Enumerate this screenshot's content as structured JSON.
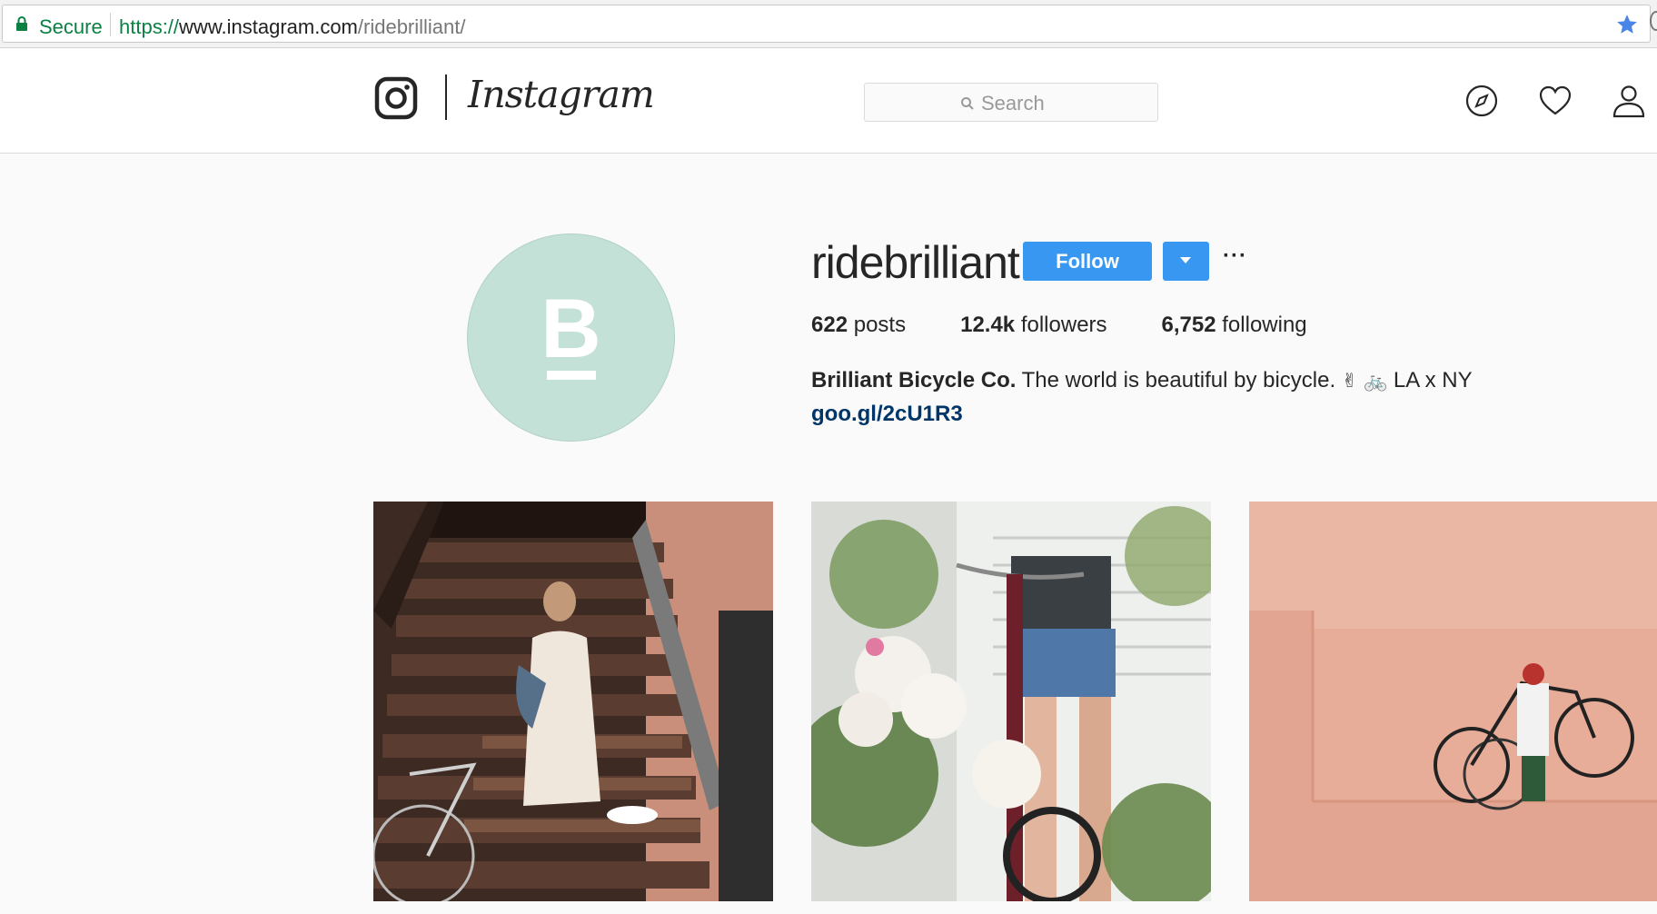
{
  "browser": {
    "secure_label": "Secure",
    "url_scheme": "https://",
    "url_host": "www.instagram.com",
    "url_path": "/ridebrilliant/",
    "secure_color": "#0b8043",
    "icons": [
      "lock-icon",
      "bookmark-star-icon"
    ]
  },
  "header": {
    "wordmark": "Instagram",
    "search_placeholder": "Search",
    "icons": [
      "instagram-glyph-icon",
      "search-icon",
      "compass-icon",
      "heart-icon",
      "person-icon"
    ]
  },
  "profile": {
    "avatar_letter": "B",
    "avatar_color": "#c3e1d7",
    "username": "ridebrilliant",
    "follow_label": "Follow",
    "more_label": "···",
    "accent_color": "#3897f0",
    "stats": {
      "posts_count": "622",
      "posts_label": "posts",
      "followers_count": "12.4k",
      "followers_label": "followers",
      "following_count": "6,752",
      "following_label": "following"
    },
    "bio": {
      "name": "Brilliant Bicycle Co.",
      "text": "The world is beautiful by bicycle.",
      "emoji_victory": "✌",
      "emoji_bicycle": "🚲",
      "location": "LA x NY",
      "link": "goo.gl/2cU1R3"
    }
  },
  "posts": [
    {
      "subject": "woman seated on brownstone stairs with bicycle"
    },
    {
      "subject": "person holding maroon bicycle behind white roses"
    },
    {
      "subject": "person carrying two bicycles against pink wall"
    }
  ]
}
